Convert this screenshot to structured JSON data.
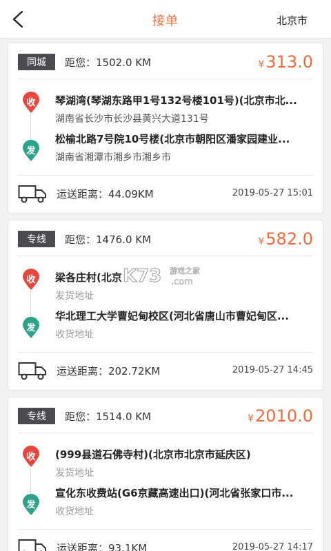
{
  "header": {
    "title": "接单",
    "city": "北京市"
  },
  "orders": [
    {
      "type": "同城",
      "distance_to_you": "距您：1502.0 KM",
      "currency": "¥",
      "price": "313.0",
      "pickup_label": "收",
      "pickup_title": "琴湖湾(琴湖东路甲1号132号楼101号)(北京市北...",
      "pickup_sub": "湖南省长沙市长沙县黄兴大道131号",
      "delivery_label": "发",
      "delivery_title": "松榆北路7号院10号楼(北京市朝阳区潘家园建业...",
      "delivery_sub": "湖南省湘潭市湘乡市湘乡市",
      "ship_distance": "运送距离：44.09KM",
      "time": "2019-05-27 15:01"
    },
    {
      "type": "专线",
      "distance_to_you": "距您：1476.0 KM",
      "currency": "¥",
      "price": "582.0",
      "pickup_label": "收",
      "pickup_title": "梁各庄村(北京",
      "pickup_sub": "发货地址",
      "delivery_label": "发",
      "delivery_title": "华北理工大学曹妃甸校区(河北省唐山市曹妃甸区...",
      "delivery_sub": "收货地址",
      "ship_distance": "运送距离：202.72KM",
      "time": "2019-05-27 14:45"
    },
    {
      "type": "专线",
      "distance_to_you": "距您：1514.0 KM",
      "currency": "¥",
      "price": "2010.0",
      "pickup_label": "收",
      "pickup_title": "(999县道石佛寺村)(北京市北京市延庆区)",
      "pickup_sub": "发货地址",
      "delivery_label": "发",
      "delivery_title": "宣化东收费站(G6京藏高速出口)(河北省张家口市...",
      "delivery_sub": "收货地址",
      "ship_distance": "运送距离：93.1KM",
      "time": "2019-05-27 14:17"
    }
  ],
  "watermark": {
    "logo": "K73",
    "text": "游戏之家",
    "domain": ".com"
  },
  "colors": {
    "accent": "#f06a3a",
    "pickup_pin": "#e8453c",
    "delivery_pin": "#2aa38a",
    "badge": "#4a4a50"
  },
  "icons": {
    "back": "chevron-left-icon",
    "truck": "truck-icon",
    "pin": "map-pin-icon"
  }
}
